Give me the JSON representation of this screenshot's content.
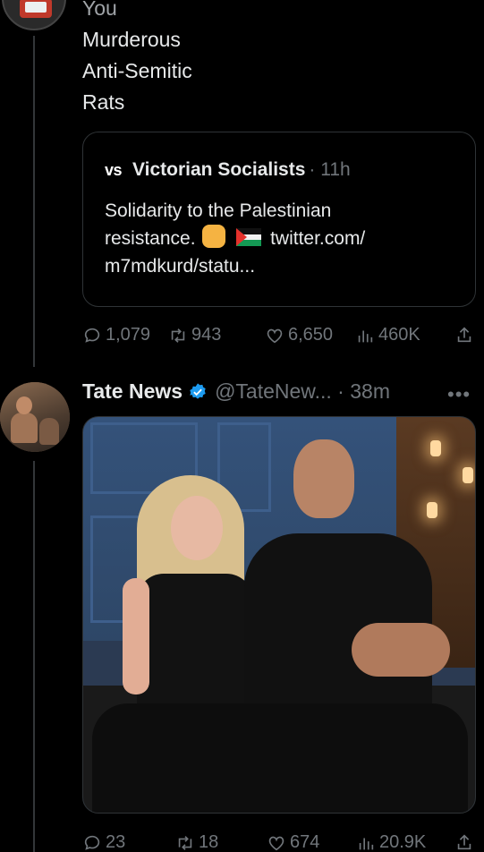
{
  "colors": {
    "background": "#000000",
    "text": "#e7e9ea",
    "muted": "#71767b",
    "border": "#2f3336",
    "verified": "#1d9bf0"
  },
  "first_tweet": {
    "lines": [
      "You",
      "Murderous",
      "Anti-Semitic",
      "Rats"
    ],
    "quote": {
      "logo": "vs",
      "name": "Victorian Socialists",
      "meta": "· 11h",
      "body_line1": "Solidarity to the Palestinian",
      "body_line2_a": "resistance.",
      "body_line2_b": "twitter.com/",
      "body_line3": "m7mdkurd/statu..."
    },
    "actions": {
      "replies": "1,079",
      "retweets": "943",
      "likes": "6,650",
      "views": "460K"
    }
  },
  "second_tweet": {
    "name": "Tate News",
    "meta": "@TateNew... · 38m",
    "more": "•••",
    "actions": {
      "replies": "23",
      "retweets": "18",
      "likes": "674",
      "views": "20.9K"
    }
  },
  "icons": [
    "reply-icon",
    "retweet-icon",
    "like-icon",
    "views-icon",
    "share-icon",
    "verified-icon",
    "more-icon"
  ]
}
